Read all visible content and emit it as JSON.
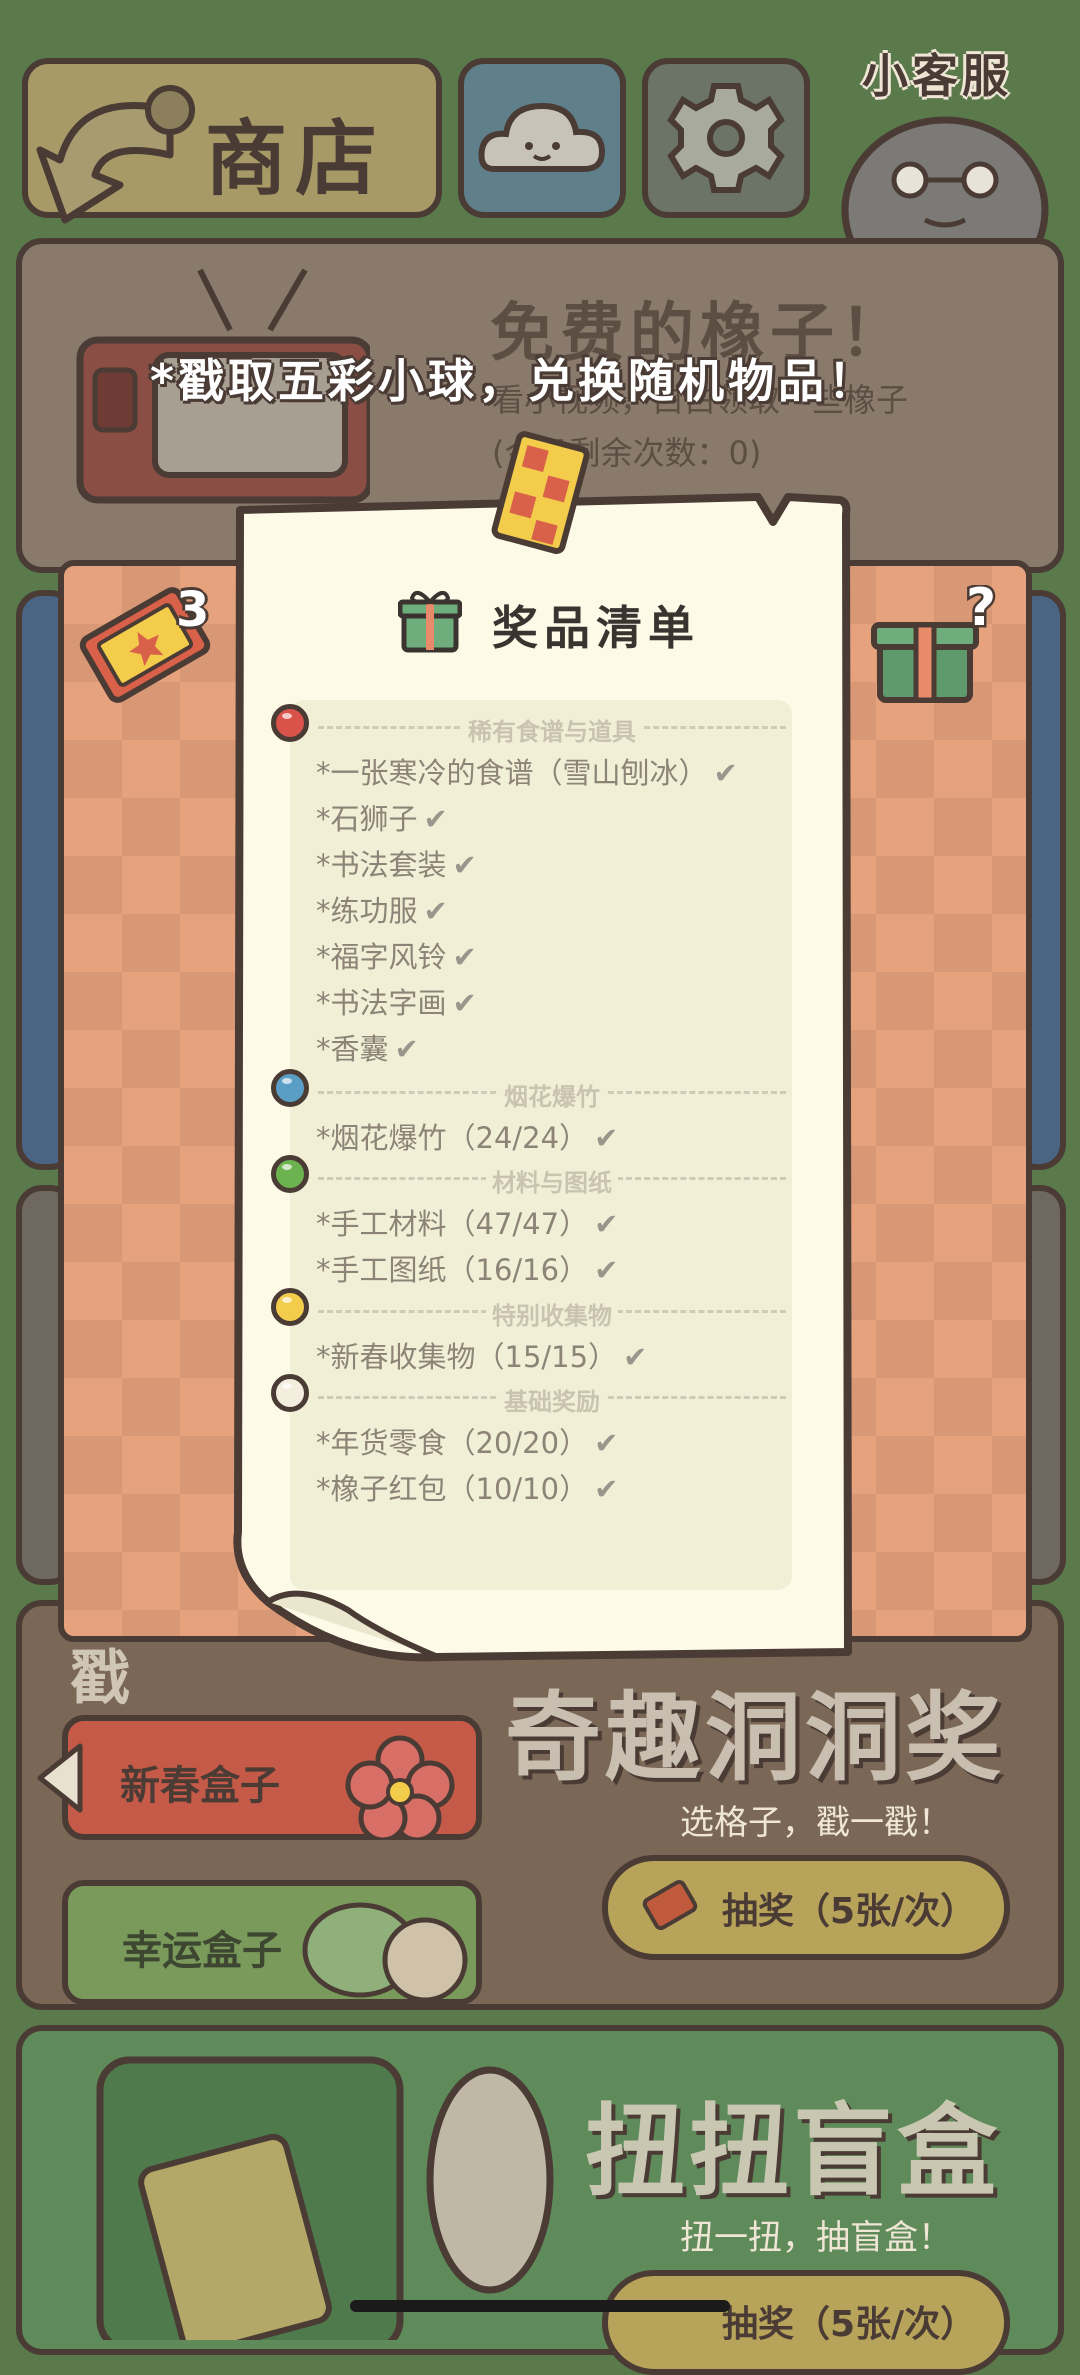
{
  "top_bar": {
    "shop_label": "商店",
    "customer_service_label": "小客服"
  },
  "free_acorns": {
    "title": "免费的橡子！",
    "subtitle": "看小视频，白白领取一些橡子",
    "remaining_label": "(今日剩余次数：0)"
  },
  "popup": {
    "headline": "*戳取五彩小球，兑换随机物品！",
    "ticket_count": "3",
    "title": "奖品清单",
    "sections": [
      {
        "ball_color": "#d9534a",
        "header": "稀有食谱与道具",
        "items": [
          "*一张寒冷的食谱（雪山刨冰）",
          "*石狮子",
          "*书法套装",
          "*练功服",
          "*福字风铃",
          "*书法字画",
          "*香囊"
        ]
      },
      {
        "ball_color": "#5a9ec6",
        "header": "烟花爆竹",
        "items": [
          "*烟花爆竹（24/24）"
        ]
      },
      {
        "ball_color": "#6cb24e",
        "header": "材料与图纸",
        "items": [
          "*手工材料（47/47）",
          "*手工图纸（16/16）"
        ]
      },
      {
        "ball_color": "#f2cc4a",
        "header": "特别收集物",
        "items": [
          "*新春收集物（15/15）"
        ]
      },
      {
        "ball_color": "#f3eedd",
        "header": "基础奖励",
        "items": [
          "*年货零食（20/20）",
          "*橡子红包（10/10）"
        ]
      }
    ],
    "check_glyph": "✔"
  },
  "lottery_card": {
    "title": "奇趣洞洞奖",
    "subtitle": "选格子，戳一戳！",
    "draw_label": "抽奖（5张/次）",
    "tab_newyear": "新春盒子",
    "tab_lucky": "幸运盒子",
    "stamp": "戳"
  },
  "gacha_card": {
    "title": "扭扭盲盒",
    "subtitle": "扭一扭，抽盲盒！",
    "draw_label": "抽奖（5张/次）"
  },
  "colors": {
    "outline": "#4a3b35",
    "paper": "#fdfbe8",
    "board": "#e6a27c",
    "list_bg": "#f1f0d6"
  }
}
